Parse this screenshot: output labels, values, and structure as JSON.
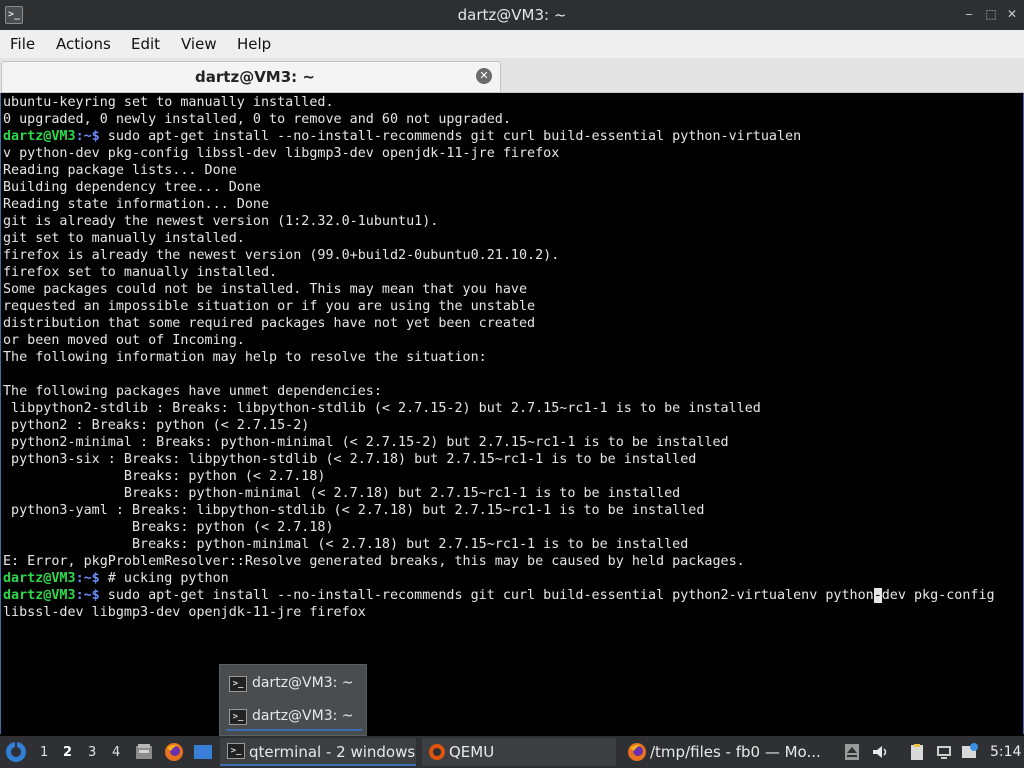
{
  "window": {
    "title": "dartz@VM3: ~",
    "controls": {
      "minimize": "‒",
      "maximize": "⬚",
      "close": "✕"
    }
  },
  "menu": [
    "File",
    "Actions",
    "Edit",
    "View",
    "Help"
  ],
  "tab": {
    "title": "dartz@VM3: ~",
    "close": "✕"
  },
  "terminal": {
    "prompt_user": "dartz@VM3",
    "prompt_tail": ":~$",
    "lines": [
      {
        "text": "ubuntu-keyring set to manually installed."
      },
      {
        "text": "0 upgraded, 0 newly installed, 0 to remove and 60 not upgraded."
      },
      {
        "prompt": true,
        "text": " sudo apt-get install --no-install-recommends git curl build-essential python-virtualen"
      },
      {
        "text": "v python-dev pkg-config libssl-dev libgmp3-dev openjdk-11-jre firefox"
      },
      {
        "text": "Reading package lists... Done"
      },
      {
        "text": "Building dependency tree... Done"
      },
      {
        "text": "Reading state information... Done"
      },
      {
        "text": "git is already the newest version (1:2.32.0-1ubuntu1)."
      },
      {
        "text": "git set to manually installed."
      },
      {
        "text": "firefox is already the newest version (99.0+build2-0ubuntu0.21.10.2)."
      },
      {
        "text": "firefox set to manually installed."
      },
      {
        "text": "Some packages could not be installed. This may mean that you have"
      },
      {
        "text": "requested an impossible situation or if you are using the unstable"
      },
      {
        "text": "distribution that some required packages have not yet been created"
      },
      {
        "text": "or been moved out of Incoming."
      },
      {
        "text": "The following information may help to resolve the situation:"
      },
      {
        "text": ""
      },
      {
        "text": "The following packages have unmet dependencies:"
      },
      {
        "text": " libpython2-stdlib : Breaks: libpython-stdlib (< 2.7.15-2) but 2.7.15~rc1-1 is to be installed"
      },
      {
        "text": " python2 : Breaks: python (< 2.7.15-2)"
      },
      {
        "text": " python2-minimal : Breaks: python-minimal (< 2.7.15-2) but 2.7.15~rc1-1 is to be installed"
      },
      {
        "text": " python3-six : Breaks: libpython-stdlib (< 2.7.18) but 2.7.15~rc1-1 is to be installed"
      },
      {
        "text": "               Breaks: python (< 2.7.18)"
      },
      {
        "text": "               Breaks: python-minimal (< 2.7.18) but 2.7.15~rc1-1 is to be installed"
      },
      {
        "text": " python3-yaml : Breaks: libpython-stdlib (< 2.7.18) but 2.7.15~rc1-1 is to be installed"
      },
      {
        "text": "                Breaks: python (< 2.7.18)"
      },
      {
        "text": "                Breaks: python-minimal (< 2.7.18) but 2.7.15~rc1-1 is to be installed"
      },
      {
        "text": "E: Error, pkgProblemResolver::Resolve generated breaks, this may be caused by held packages."
      },
      {
        "prompt": true,
        "text": " # ucking python"
      },
      {
        "prompt": true,
        "text": " sudo apt-get install --no-install-recommends git curl build-essential python2-virtualenv python",
        "cursor": "-",
        "after": "dev pkg-config"
      },
      {
        "text": "libssl-dev libgmp3-dev openjdk-11-jre firefox"
      }
    ]
  },
  "window_popup": {
    "items": [
      "dartz@VM3: ~",
      "dartz@VM3: ~"
    ]
  },
  "taskbar": {
    "desktops": [
      "1",
      "2",
      "3",
      "4"
    ],
    "active_desktop": "2",
    "tasks": [
      {
        "label": "qterminal - 2 windows",
        "icon": "terminal-icon"
      },
      {
        "label": "QEMU",
        "icon": "qemu-icon"
      },
      {
        "label": "/tmp/files - fb0 — Mo...",
        "icon": "firefox-icon"
      }
    ],
    "clock": "5:14"
  },
  "colors": {
    "prompt_user": "#2fd84a",
    "prompt_tail": "#6a8cff",
    "terminal_bg": "#000000",
    "taskbar_bg": "#2e3033",
    "accent": "#3b6fb0"
  }
}
